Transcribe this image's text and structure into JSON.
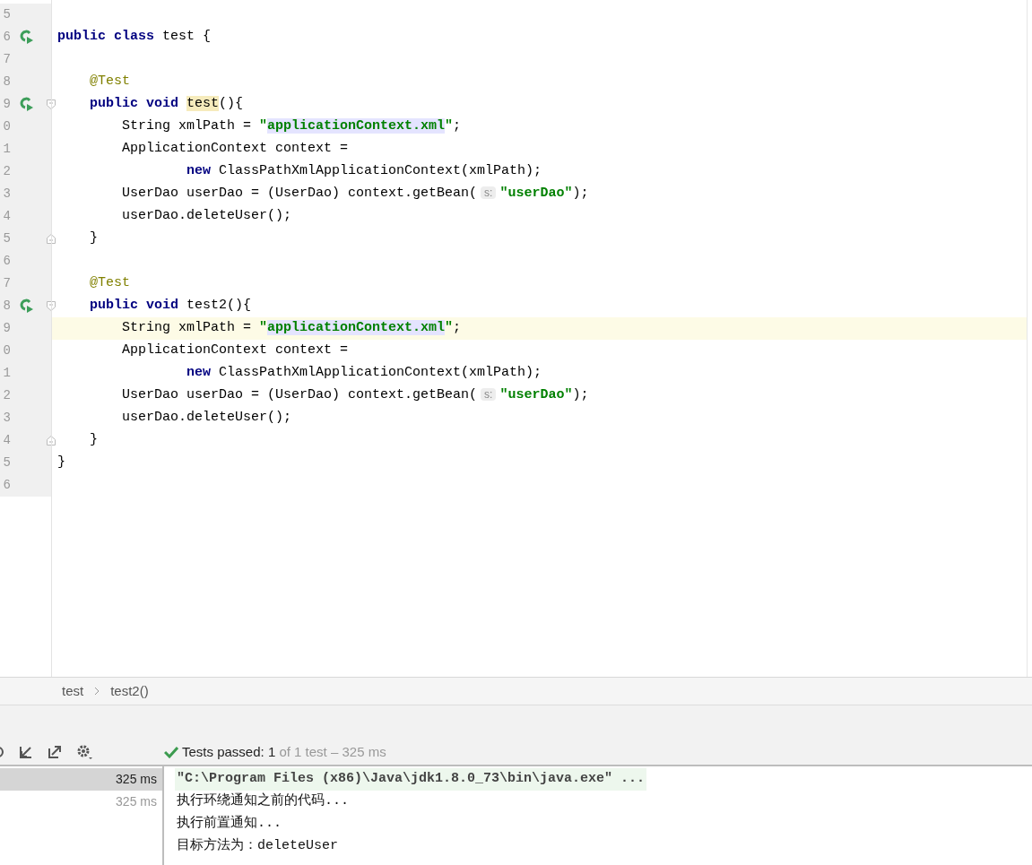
{
  "editor": {
    "lines": [
      {
        "number": "5",
        "kind": "blank"
      },
      {
        "number": "6",
        "kind": "top",
        "run_icon": true,
        "tokens": [
          {
            "kind": "keyword",
            "text": "public class "
          },
          {
            "kind": "plain",
            "text": "test {"
          }
        ]
      },
      {
        "number": "7",
        "kind": "blank"
      },
      {
        "number": "8",
        "kind": "member",
        "tokens": [
          {
            "kind": "annotation",
            "text": "@Test"
          }
        ]
      },
      {
        "number": "9",
        "kind": "member",
        "run_icon": true,
        "fold_open": true,
        "tokens": [
          {
            "kind": "keyword",
            "text": "public void "
          },
          {
            "kind": "usage",
            "text": "test"
          },
          {
            "kind": "plain",
            "text": "(){"
          }
        ]
      },
      {
        "number": "0",
        "kind": "statement",
        "tokens": [
          {
            "kind": "plain",
            "text": "String xmlPath = "
          },
          {
            "kind": "string",
            "text": "\""
          },
          {
            "kind": "injected",
            "text": "applicationContext.xml"
          },
          {
            "kind": "string",
            "text": "\""
          },
          {
            "kind": "plain",
            "text": ";"
          }
        ]
      },
      {
        "number": "1",
        "kind": "statement",
        "tokens": [
          {
            "kind": "plain",
            "text": "ApplicationContext context ="
          }
        ]
      },
      {
        "number": "2",
        "kind": "continuation",
        "tokens": [
          {
            "kind": "keyword",
            "text": "new "
          },
          {
            "kind": "plain",
            "text": "ClassPathXmlApplicationContext(xmlPath);"
          }
        ]
      },
      {
        "number": "3",
        "kind": "statement",
        "tokens": [
          {
            "kind": "plain",
            "text": "UserDao userDao = (UserDao) context.getBean("
          },
          {
            "kind": "hint",
            "text": "s:"
          },
          {
            "kind": "string",
            "text": "\"userDao\""
          },
          {
            "kind": "plain",
            "text": ");"
          }
        ]
      },
      {
        "number": "4",
        "kind": "statement",
        "tokens": [
          {
            "kind": "plain",
            "text": "userDao.deleteUser();"
          }
        ]
      },
      {
        "number": "5",
        "kind": "member",
        "fold_close": true,
        "tokens": [
          {
            "kind": "plain",
            "text": "}"
          }
        ]
      },
      {
        "number": "6",
        "kind": "blank"
      },
      {
        "number": "7",
        "kind": "member",
        "tokens": [
          {
            "kind": "annotation",
            "text": "@Test"
          }
        ]
      },
      {
        "number": "8",
        "kind": "member",
        "run_icon": true,
        "fold_open": true,
        "tokens": [
          {
            "kind": "keyword",
            "text": "public void "
          },
          {
            "kind": "plain",
            "text": "test2(){"
          }
        ]
      },
      {
        "number": "9",
        "kind": "statement",
        "current": true,
        "tokens": [
          {
            "kind": "plain",
            "text": "String xmlPath = "
          },
          {
            "kind": "string",
            "text": "\""
          },
          {
            "kind": "injected",
            "text": "applicationContext.xml"
          },
          {
            "kind": "string",
            "text": "\""
          },
          {
            "kind": "plain",
            "text": ";"
          }
        ]
      },
      {
        "number": "0",
        "kind": "statement",
        "tokens": [
          {
            "kind": "plain",
            "text": "ApplicationContext context ="
          }
        ]
      },
      {
        "number": "1",
        "kind": "continuation",
        "tokens": [
          {
            "kind": "keyword",
            "text": "new "
          },
          {
            "kind": "plain",
            "text": "ClassPathXmlApplicationContext(xmlPath);"
          }
        ]
      },
      {
        "number": "2",
        "kind": "statement",
        "tokens": [
          {
            "kind": "plain",
            "text": "UserDao userDao = (UserDao) context.getBean("
          },
          {
            "kind": "hint",
            "text": "s:"
          },
          {
            "kind": "string",
            "text": "\"userDao\""
          },
          {
            "kind": "plain",
            "text": ");"
          }
        ]
      },
      {
        "number": "3",
        "kind": "statement",
        "tokens": [
          {
            "kind": "plain",
            "text": "userDao.deleteUser();"
          }
        ]
      },
      {
        "number": "4",
        "kind": "member",
        "fold_close": true,
        "tokens": [
          {
            "kind": "plain",
            "text": "}"
          }
        ]
      },
      {
        "number": "5",
        "kind": "top",
        "tokens": [
          {
            "kind": "plain",
            "text": "}"
          }
        ]
      },
      {
        "number": "6",
        "kind": "blank"
      }
    ]
  },
  "breadcrumbs": [
    "test",
    "test2()"
  ],
  "test_status": {
    "label": "Tests passed:",
    "count": "1",
    "detail": "of 1 test – 325 ms"
  },
  "test_tree": [
    {
      "time": "325 ms",
      "selected": true
    },
    {
      "time": "325 ms",
      "selected": false
    }
  ],
  "console": [
    {
      "kind": "command",
      "text": "\"C:\\Program Files (x86)\\Java\\jdk1.8.0_73\\bin\\java.exe\" ..."
    },
    {
      "kind": "output",
      "text": "执行环绕通知之前的代码..."
    },
    {
      "kind": "output",
      "text": "执行前置通知..."
    },
    {
      "kind": "output",
      "text": "目标方法为：deleteUser"
    }
  ]
}
